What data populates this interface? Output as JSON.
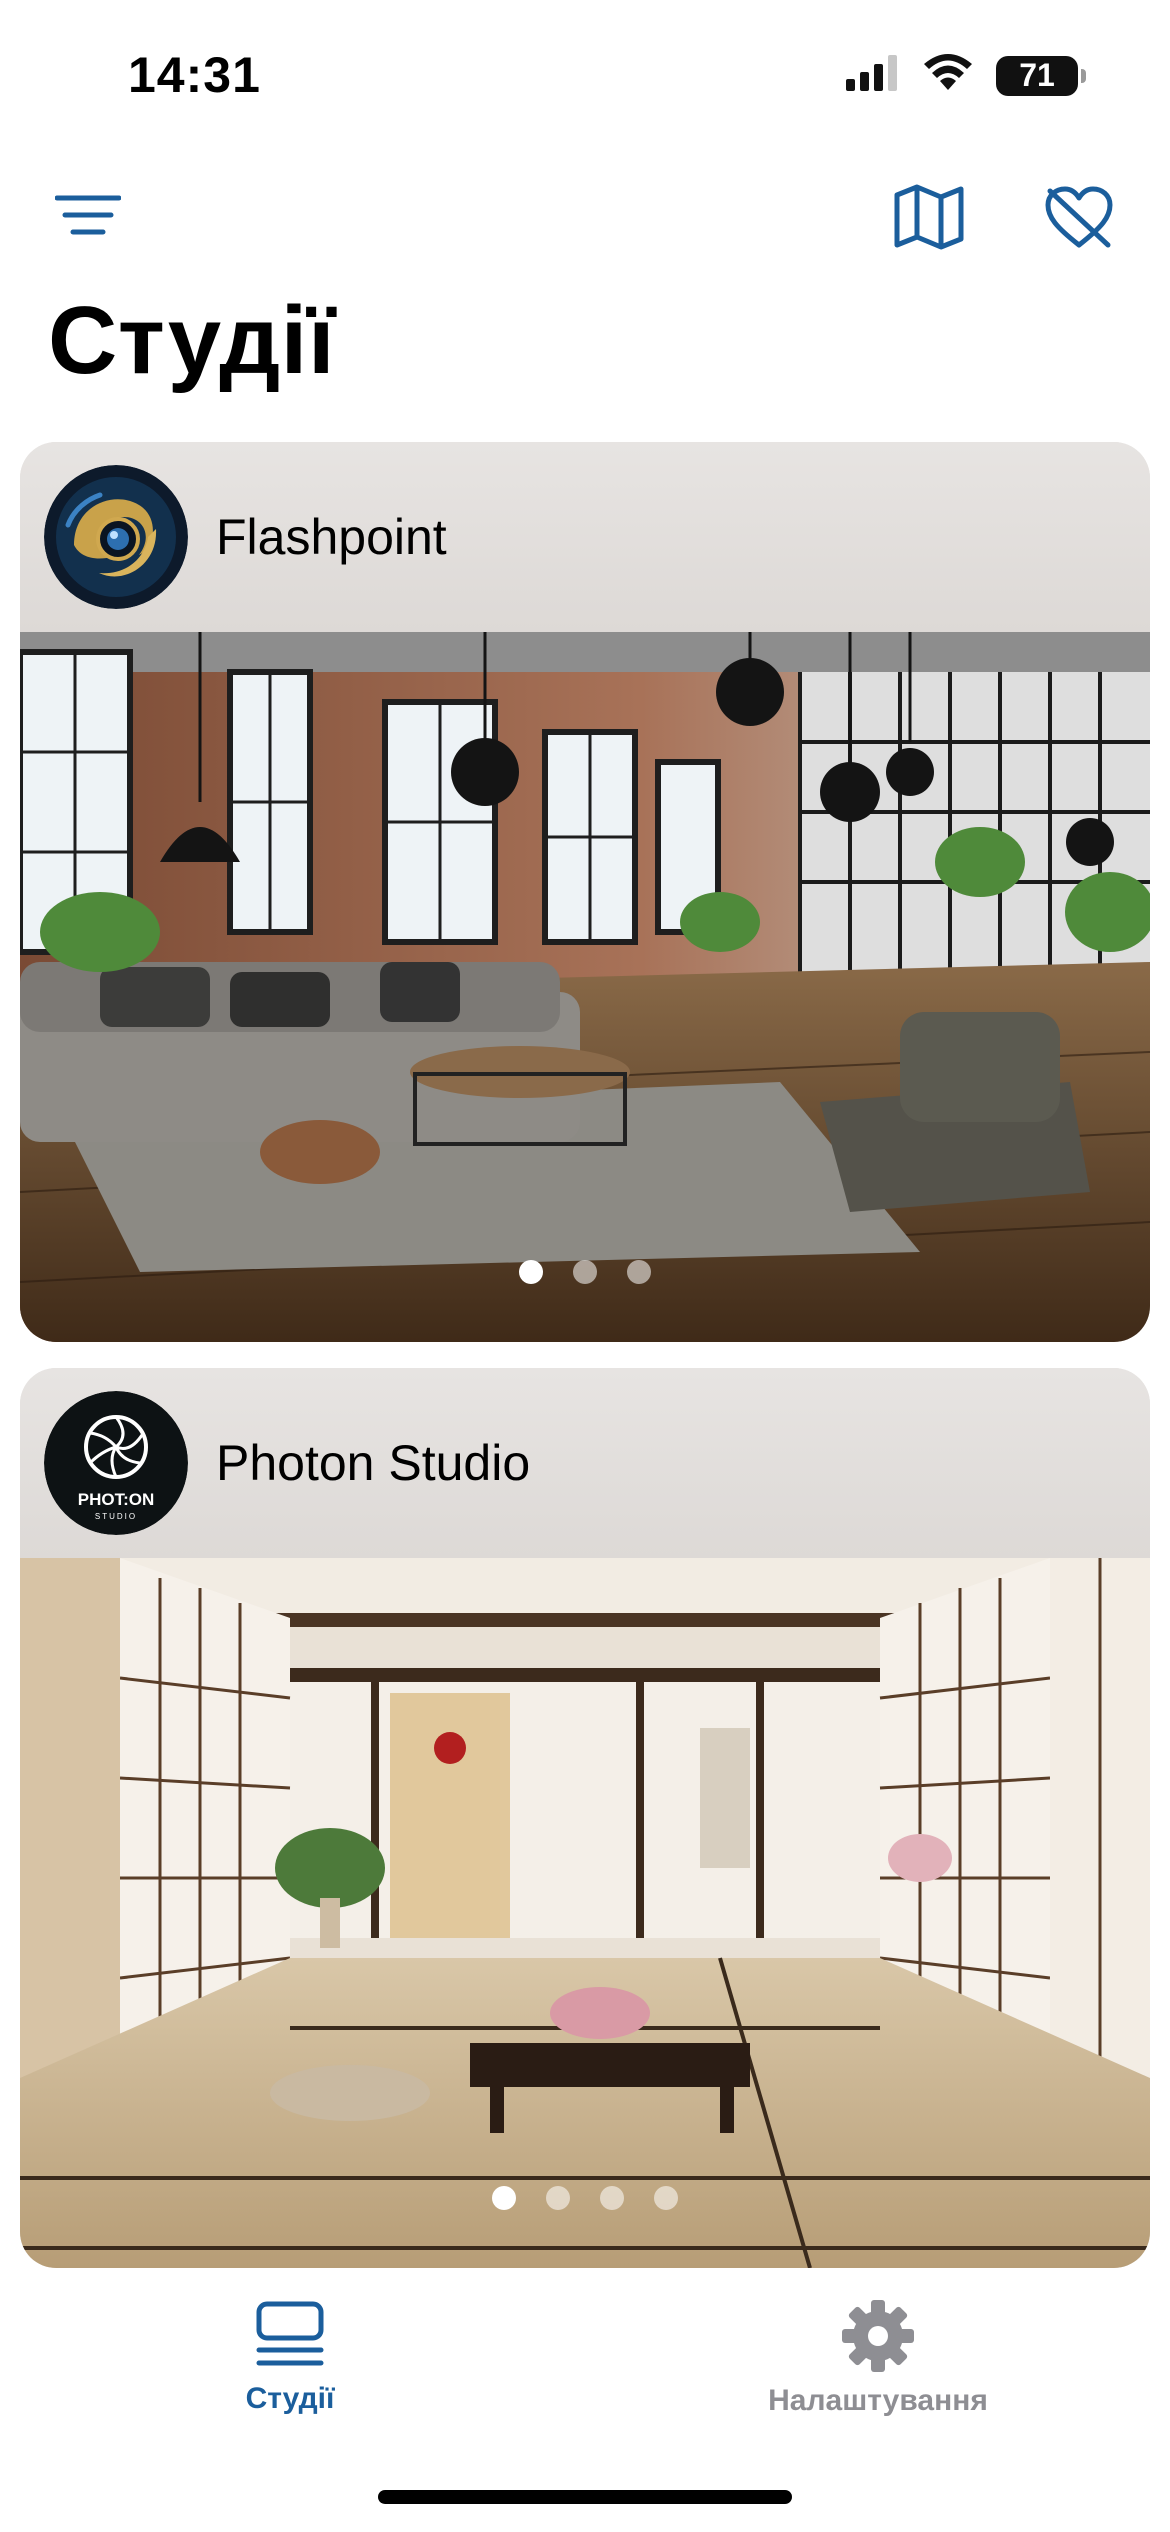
{
  "status_bar": {
    "time": "14:31",
    "battery": "71",
    "icons": [
      "signal-icon",
      "wifi-icon",
      "battery-icon"
    ]
  },
  "nav": {
    "menu_icon": "menu-lines-icon",
    "map_icon": "map-icon",
    "favorites_icon": "heart-slash-icon"
  },
  "title": "Студії",
  "studios": [
    {
      "name": "Flashpoint",
      "photo_count": 3,
      "active_photo": 1,
      "avatar_icon": "ornate-camera-lens-logo"
    },
    {
      "name": "Photon Studio",
      "photo_count": 4,
      "active_photo": 1,
      "avatar_text": "PHOT:ON",
      "avatar_subtext": "STUDIO"
    }
  ],
  "tab_bar": {
    "tabs": [
      {
        "label": "Студії",
        "icon": "list-icon",
        "active": true
      },
      {
        "label": "Налаштування",
        "icon": "gear-icon",
        "active": false
      }
    ]
  },
  "colors": {
    "accent": "#1b5e9c",
    "inactive": "#8e8e93",
    "card_header": "#e3e0dd"
  }
}
